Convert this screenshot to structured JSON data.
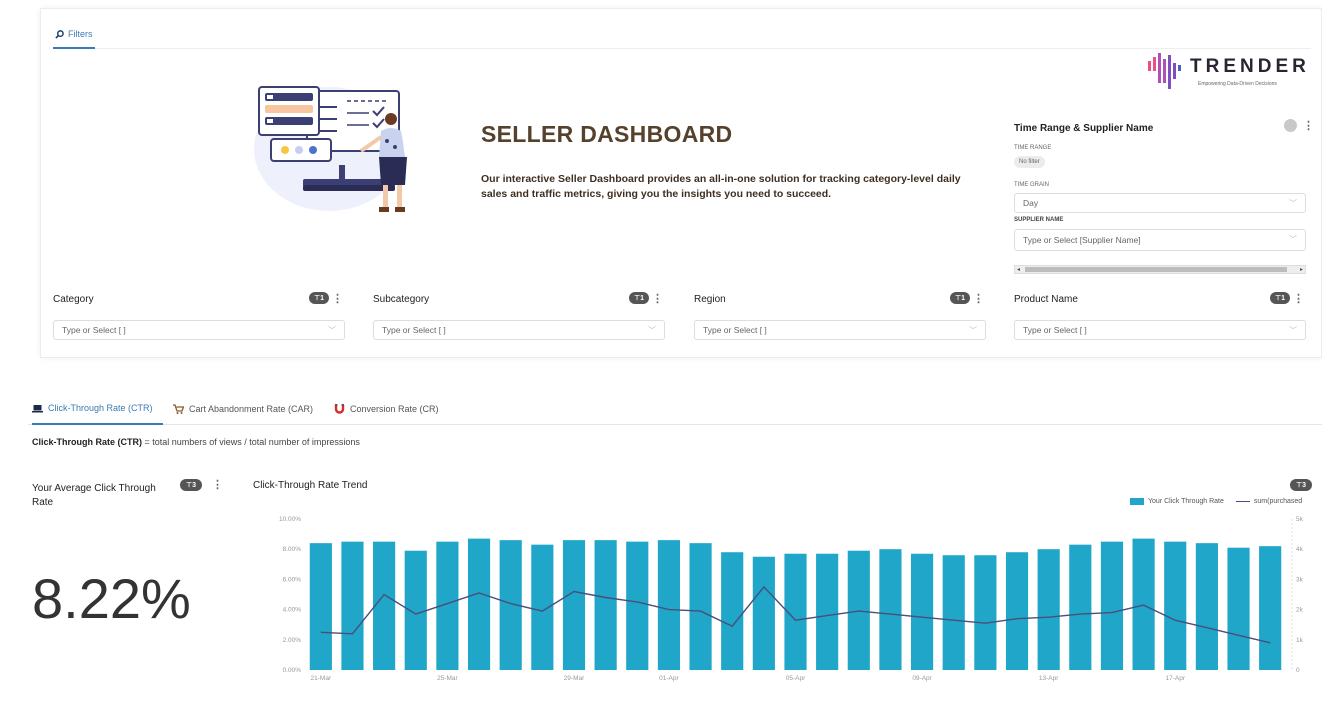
{
  "filters_tab": {
    "label": "Filters",
    "icon": "filter-icon"
  },
  "hero": {
    "title": "SELLER DASHBOARD",
    "description": "Our interactive Seller Dashboard provides an all-in-one solution for tracking category-level daily sales and traffic metrics, giving you the insights you need to succeed."
  },
  "logo": {
    "name": "TRENDER",
    "tagline": "Empowering Data-Driven Decisions"
  },
  "time_supplier": {
    "title": "Time Range & Supplier Name",
    "time_range_label": "TIME RANGE",
    "time_range_value": "No filter",
    "time_grain_label": "TIME GRAIN",
    "time_grain_value": "Day",
    "supplier_label": "SUPPLIER NAME",
    "supplier_placeholder": "Type or Select [Supplier Name]"
  },
  "filter_columns": [
    {
      "name": "Category",
      "badge": "1",
      "placeholder": "Type or Select [ ]"
    },
    {
      "name": "Subcategory",
      "badge": "1",
      "placeholder": "Type or Select [ ]"
    },
    {
      "name": "Region",
      "badge": "1",
      "placeholder": "Type or Select [ ]"
    },
    {
      "name": "Product Name",
      "badge": "1",
      "placeholder": "Type or Select [ ]"
    }
  ],
  "metric_tabs": [
    {
      "label": "Click-Through Rate (CTR)",
      "icon": "laptop-icon",
      "active": true
    },
    {
      "label": "Cart Abandonment Rate (CAR)",
      "icon": "cart-icon",
      "active": false
    },
    {
      "label": "Conversion Rate (CR)",
      "icon": "magnet-icon",
      "active": false
    }
  ],
  "ctr_definition": {
    "term": "Click-Through Rate (CTR)",
    "text": " = total numbers of views / total number of impressions"
  },
  "avg_card": {
    "title": "Your Average Click Through Rate",
    "badge": "3",
    "value": "8.22%"
  },
  "trend_card": {
    "title": "Click-Through Rate Trend",
    "badge": "3"
  },
  "colors": {
    "accent": "#3a7bb5",
    "bar": "#1fa6c8",
    "line": "#4a4f7a",
    "title_brown": "#55412c"
  },
  "chart_data": {
    "type": "bar",
    "title": "Click-Through Rate Trend",
    "categories": [
      "21-Mar",
      "22-Mar",
      "23-Mar",
      "24-Mar",
      "25-Mar",
      "26-Mar",
      "27-Mar",
      "28-Mar",
      "29-Mar",
      "30-Mar",
      "31-Mar",
      "01-Apr",
      "02-Apr",
      "03-Apr",
      "04-Apr",
      "05-Apr",
      "06-Apr",
      "07-Apr",
      "08-Apr",
      "09-Apr",
      "10-Apr",
      "11-Apr",
      "12-Apr",
      "13-Apr",
      "14-Apr",
      "15-Apr",
      "16-Apr",
      "17-Apr",
      "18-Apr",
      "19-Apr",
      "20-Apr"
    ],
    "x_tick_labels": [
      "21-Mar",
      "25-Mar",
      "29-Mar",
      "01-Apr",
      "05-Apr",
      "09-Apr",
      "13-Apr",
      "17-Apr"
    ],
    "series": [
      {
        "name": "Your Click Through Rate",
        "axis": "left",
        "kind": "bar",
        "values": [
          8.4,
          8.5,
          8.5,
          7.9,
          8.5,
          8.7,
          8.6,
          8.3,
          8.6,
          8.6,
          8.5,
          8.6,
          8.4,
          7.8,
          7.5,
          7.7,
          7.7,
          7.9,
          8.0,
          7.7,
          7.6,
          7.6,
          7.8,
          8.0,
          8.3,
          8.5,
          8.7,
          8.5,
          8.4,
          8.1,
          8.2
        ]
      },
      {
        "name": "sum(purchased",
        "axis": "right",
        "kind": "line",
        "values": [
          1250,
          1200,
          2500,
          1850,
          2200,
          2550,
          2200,
          1950,
          2600,
          2400,
          2250,
          2000,
          1950,
          1450,
          2750,
          1650,
          1800,
          1950,
          1850,
          1750,
          1650,
          1550,
          1700,
          1750,
          1850,
          1900,
          2150,
          1650,
          1400,
          1150,
          900
        ]
      }
    ],
    "y_left": {
      "ticks": [
        "0.00%",
        "2.00%",
        "4.00%",
        "6.00%",
        "8.00%",
        "10.00%"
      ],
      "range": [
        0,
        10
      ]
    },
    "y_right": {
      "ticks": [
        "0",
        "1k",
        "2k",
        "3k",
        "4k",
        "5k"
      ],
      "range": [
        0,
        5000
      ]
    },
    "legend_position": "top-right",
    "grid": false
  }
}
